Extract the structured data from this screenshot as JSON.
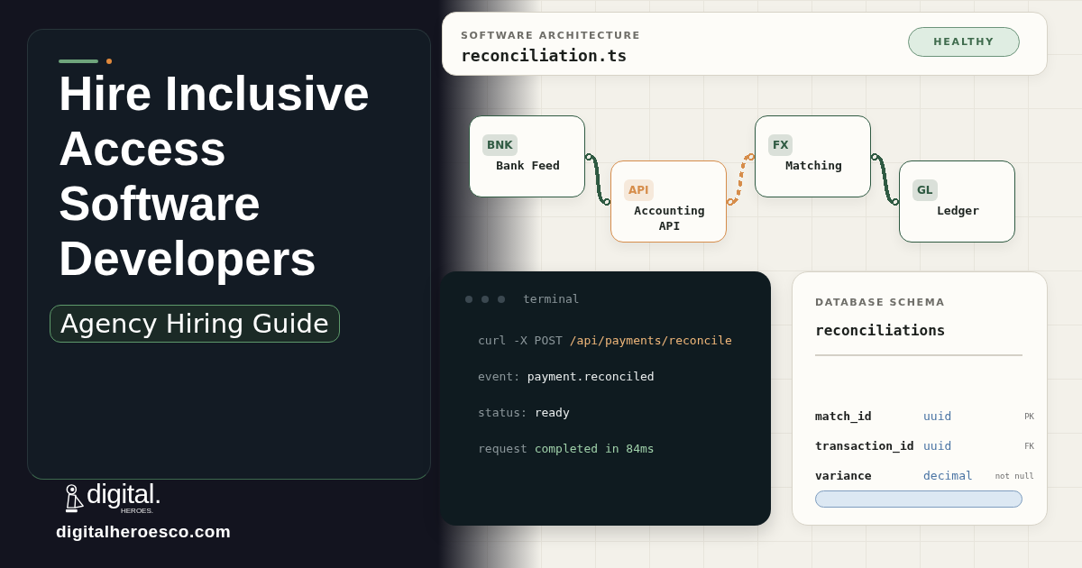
{
  "hero": {
    "title": "Hire Inclusive Access Software Developers",
    "badge": "Agency Hiring Guide"
  },
  "brand": {
    "logo_text": "digital.",
    "logo_subtext": "HEROES.",
    "website": "digitalheroesco.com"
  },
  "architecture": {
    "label": "SOFTWARE ARCHITECTURE",
    "file": "reconciliation.ts",
    "status": "HEALTHY",
    "nodes": [
      {
        "tag": "BNK",
        "label": "Bank Feed",
        "color": "#2f5a42"
      },
      {
        "tag": "API",
        "label": "Accounting API",
        "color": "#d68d4b"
      },
      {
        "tag": "FX",
        "label": "Matching",
        "color": "#2f5a42"
      },
      {
        "tag": "GL",
        "label": "Ledger",
        "color": "#2f5a42"
      }
    ],
    "connectors": [
      {
        "kind": "solid",
        "color": "#2f5a42"
      },
      {
        "kind": "dashed",
        "color": "#d68d4b"
      },
      {
        "kind": "solid",
        "color": "#2f5a42"
      }
    ]
  },
  "terminal": {
    "title": "terminal",
    "lines": [
      {
        "kind": "command",
        "key": "curl -X POST",
        "value": "/api/payments/reconcile"
      },
      {
        "kind": "field",
        "key": "event:",
        "value": "payment.reconciled"
      },
      {
        "kind": "field",
        "key": "status:",
        "value": "ready"
      },
      {
        "kind": "success",
        "key": "request",
        "value": "completed in 84ms"
      }
    ]
  },
  "schema": {
    "label": "DATABASE SCHEMA",
    "table": "reconciliations",
    "columns": [
      {
        "name": "match_id",
        "type": "uuid",
        "constraint": "PK"
      },
      {
        "name": "transaction_id",
        "type": "uuid",
        "constraint": "FK"
      },
      {
        "name": "variance",
        "type": "decimal",
        "constraint": "not null"
      }
    ]
  }
}
